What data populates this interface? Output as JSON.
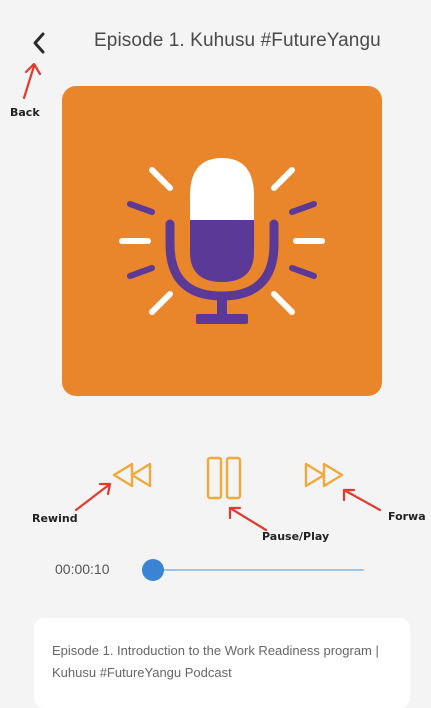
{
  "header": {
    "title": "Episode 1. Kuhusu #FutureYangu"
  },
  "annotations": {
    "back": "Back",
    "rewind": "Rewind",
    "pause_play": "Pause/Play",
    "forward": "Forwa"
  },
  "player": {
    "elapsed_time": "00:00:10",
    "progress_fraction": 0.0,
    "state": "playing"
  },
  "description": {
    "text": "Episode 1. Introduction to the Work Readiness program | Kuhusu #FutureYangu Podcast"
  },
  "icons": {
    "back": "chevron-left-icon",
    "cover": "microphone-icon",
    "rewind": "rewind-icon",
    "pause": "pause-icon",
    "forward": "fast-forward-icon"
  },
  "colors": {
    "background": "#f3f4f3",
    "cover": "#e9852a",
    "mic_body": "#5b3a97",
    "controls": "#f2a93b",
    "annotation_arrow": "#e23b2e",
    "progress_knob": "#3a84d6",
    "progress_track": "#9cc3e8"
  }
}
